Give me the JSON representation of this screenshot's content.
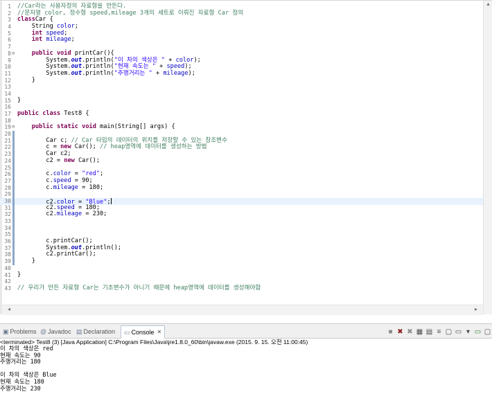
{
  "editor": {
    "lines": [
      {
        "n": "1",
        "t": [
          [
            "cm",
            "//Car라는 사용자정의 자료형을 만든다."
          ]
        ]
      },
      {
        "n": "2",
        "t": [
          [
            "cm",
            "//문자열 color, 정수형 speed,mileage 3개의 세트로 이뤄진 자료형 Car 정의"
          ]
        ]
      },
      {
        "n": "3",
        "t": [
          [
            "kw",
            "class"
          ],
          [
            "",
            "Car {"
          ]
        ]
      },
      {
        "n": "4",
        "t": [
          [
            "",
            "    String "
          ],
          [
            "fld",
            "color"
          ],
          [
            "",
            ";"
          ]
        ]
      },
      {
        "n": "5",
        "t": [
          [
            "",
            "    "
          ],
          [
            "kw",
            "int"
          ],
          [
            "",
            " "
          ],
          [
            "fld",
            "speed"
          ],
          [
            "",
            ";"
          ]
        ]
      },
      {
        "n": "6",
        "t": [
          [
            "",
            "    "
          ],
          [
            "kw",
            "int"
          ],
          [
            "",
            " "
          ],
          [
            "fld",
            "mileage"
          ],
          [
            "",
            ";"
          ]
        ]
      },
      {
        "n": "7",
        "t": []
      },
      {
        "n": "8",
        "fold": "⊖",
        "t": [
          [
            "",
            "    "
          ],
          [
            "kw",
            "public"
          ],
          [
            "",
            " "
          ],
          [
            "kw",
            "void"
          ],
          [
            "",
            " printCar(){"
          ]
        ]
      },
      {
        "n": "9",
        "t": [
          [
            "",
            "        System."
          ],
          [
            "sfld",
            "out"
          ],
          [
            "",
            ".println("
          ],
          [
            "st",
            "\"이 차의 색상은 \""
          ],
          [
            "",
            " + "
          ],
          [
            "fld",
            "color"
          ],
          [
            "",
            ");"
          ]
        ]
      },
      {
        "n": "10",
        "t": [
          [
            "",
            "        System."
          ],
          [
            "sfld",
            "out"
          ],
          [
            "",
            ".println("
          ],
          [
            "st",
            "\"현재 속도는 \""
          ],
          [
            "",
            " + "
          ],
          [
            "fld",
            "speed"
          ],
          [
            "",
            ");"
          ]
        ]
      },
      {
        "n": "11",
        "t": [
          [
            "",
            "        System."
          ],
          [
            "sfld",
            "out"
          ],
          [
            "",
            ".println("
          ],
          [
            "st",
            "\"주행거리는 \""
          ],
          [
            "",
            " + "
          ],
          [
            "fld",
            "mileage"
          ],
          [
            "",
            ");"
          ]
        ]
      },
      {
        "n": "12",
        "t": [
          [
            "",
            "    }"
          ]
        ]
      },
      {
        "n": "13",
        "t": []
      },
      {
        "n": "14",
        "t": []
      },
      {
        "n": "15",
        "t": [
          [
            "",
            "}"
          ]
        ]
      },
      {
        "n": "16",
        "t": []
      },
      {
        "n": "17",
        "t": [
          [
            "kw",
            "public"
          ],
          [
            "",
            " "
          ],
          [
            "kw",
            "class"
          ],
          [
            "",
            " Test8 {"
          ]
        ]
      },
      {
        "n": "18",
        "t": []
      },
      {
        "n": "19",
        "fold": "⊖",
        "t": [
          [
            "",
            "    "
          ],
          [
            "kw",
            "public"
          ],
          [
            "",
            " "
          ],
          [
            "kw",
            "static"
          ],
          [
            "",
            " "
          ],
          [
            "kw",
            "void"
          ],
          [
            "",
            " main(String[] args) {"
          ]
        ]
      },
      {
        "n": "20",
        "mark": true,
        "t": []
      },
      {
        "n": "21",
        "mark": true,
        "t": [
          [
            "",
            "        Car c; "
          ],
          [
            "cm",
            "// Car 타입의 데이터의 위치를 저장할 수 있는 참조변수"
          ]
        ]
      },
      {
        "n": "22",
        "mark": true,
        "t": [
          [
            "",
            "        c = "
          ],
          [
            "kw",
            "new"
          ],
          [
            "",
            " Car(); "
          ],
          [
            "cm",
            "// heap영역에 데이터를 생성하는 방법"
          ]
        ]
      },
      {
        "n": "23",
        "mark": true,
        "t": [
          [
            "",
            "        Car c2;"
          ]
        ]
      },
      {
        "n": "24",
        "mark": true,
        "t": [
          [
            "",
            "        c2 = "
          ],
          [
            "kw",
            "new"
          ],
          [
            "",
            " Car();"
          ]
        ]
      },
      {
        "n": "25",
        "mark": true,
        "t": []
      },
      {
        "n": "26",
        "mark": true,
        "t": [
          [
            "",
            "        c."
          ],
          [
            "fld",
            "color"
          ],
          [
            "",
            " = "
          ],
          [
            "st",
            "\"red\""
          ],
          [
            "",
            ";"
          ]
        ]
      },
      {
        "n": "27",
        "mark": true,
        "t": [
          [
            "",
            "        c."
          ],
          [
            "fld",
            "speed"
          ],
          [
            "",
            " = 90;"
          ]
        ]
      },
      {
        "n": "28",
        "mark": true,
        "t": [
          [
            "",
            "        c."
          ],
          [
            "fld",
            "mileage"
          ],
          [
            "",
            " = 180;"
          ]
        ]
      },
      {
        "n": "29",
        "mark": true,
        "t": []
      },
      {
        "n": "30",
        "mark": true,
        "current": true,
        "caret": true,
        "t": [
          [
            "",
            "        c2."
          ],
          [
            "fld",
            "color"
          ],
          [
            "",
            " = "
          ],
          [
            "st",
            "\"Blue\""
          ],
          [
            "",
            ";"
          ]
        ]
      },
      {
        "n": "31",
        "mark": true,
        "t": [
          [
            "",
            "        c2."
          ],
          [
            "fld",
            "speed"
          ],
          [
            "",
            " = 180;"
          ]
        ]
      },
      {
        "n": "32",
        "mark": true,
        "t": [
          [
            "",
            "        c2."
          ],
          [
            "fld",
            "mileage"
          ],
          [
            "",
            " = 230;"
          ]
        ]
      },
      {
        "n": "33",
        "mark": true,
        "t": []
      },
      {
        "n": "34",
        "mark": true,
        "t": []
      },
      {
        "n": "35",
        "mark": true,
        "t": []
      },
      {
        "n": "36",
        "mark": true,
        "t": [
          [
            "",
            "        c.printCar();"
          ]
        ]
      },
      {
        "n": "37",
        "mark": true,
        "t": [
          [
            "",
            "        System."
          ],
          [
            "sfld",
            "out"
          ],
          [
            "",
            ".println();"
          ]
        ]
      },
      {
        "n": "38",
        "mark": true,
        "t": [
          [
            "",
            "        c2.printCar();"
          ]
        ]
      },
      {
        "n": "39",
        "mark": true,
        "t": [
          [
            "",
            "    }"
          ]
        ]
      },
      {
        "n": "40",
        "t": []
      },
      {
        "n": "41",
        "t": [
          [
            "",
            "}"
          ]
        ]
      },
      {
        "n": "42",
        "t": []
      },
      {
        "n": "43",
        "t": [
          [
            "cm",
            "// 우리가 만든 자료형 Car는 기초변수가 아니기 때문에 heap영역에 데이터를 생성해야함"
          ]
        ]
      }
    ]
  },
  "tabs": [
    {
      "id": "problems",
      "label": "Problems",
      "icon": "problems-icon",
      "glyph": "▣"
    },
    {
      "id": "javadoc",
      "label": "Javadoc",
      "icon": "javadoc-icon",
      "glyph": "@"
    },
    {
      "id": "declaration",
      "label": "Declaration",
      "icon": "declaration-icon",
      "glyph": "▤"
    },
    {
      "id": "console",
      "label": "Console",
      "icon": "console-icon",
      "glyph": "▭",
      "active": true
    }
  ],
  "toolbar": [
    {
      "icon": "terminate-icon",
      "glyph": "■",
      "cls": "gray"
    },
    {
      "icon": "remove-launch-icon",
      "glyph": "✖",
      "cls": "red"
    },
    {
      "icon": "remove-all-terminated-icon",
      "glyph": "✖",
      "cls": "gray"
    },
    {
      "icon": "clear-console-icon",
      "glyph": "▦",
      "cls": ""
    },
    {
      "icon": "scroll-lock-icon",
      "glyph": "▤",
      "cls": ""
    },
    {
      "icon": "word-wrap-icon",
      "glyph": "≡",
      "cls": ""
    },
    {
      "icon": "pin-console-icon",
      "glyph": "▢",
      "cls": ""
    },
    {
      "icon": "display-selected-console-icon",
      "glyph": "▭",
      "cls": ""
    },
    {
      "icon": "open-console-icon",
      "glyph": "▾",
      "cls": ""
    },
    {
      "icon": "minimize-icon",
      "glyph": "▭",
      "cls": "green"
    },
    {
      "icon": "maximize-icon",
      "glyph": "▢",
      "cls": ""
    }
  ],
  "console": {
    "status": "<terminated> Test8 (3) [Java Application] C:\\Program Files\\Java\\jre1.8.0_60\\bin\\javaw.exe (2015. 9. 15. 오전 11:00:45)",
    "output": [
      "이 차의 색상은 red",
      "현재 속도는 90",
      "주행거리는 180",
      "",
      "이 차의 색상은 Blue",
      "현재 속도는 180",
      "주행거리는 230"
    ]
  }
}
